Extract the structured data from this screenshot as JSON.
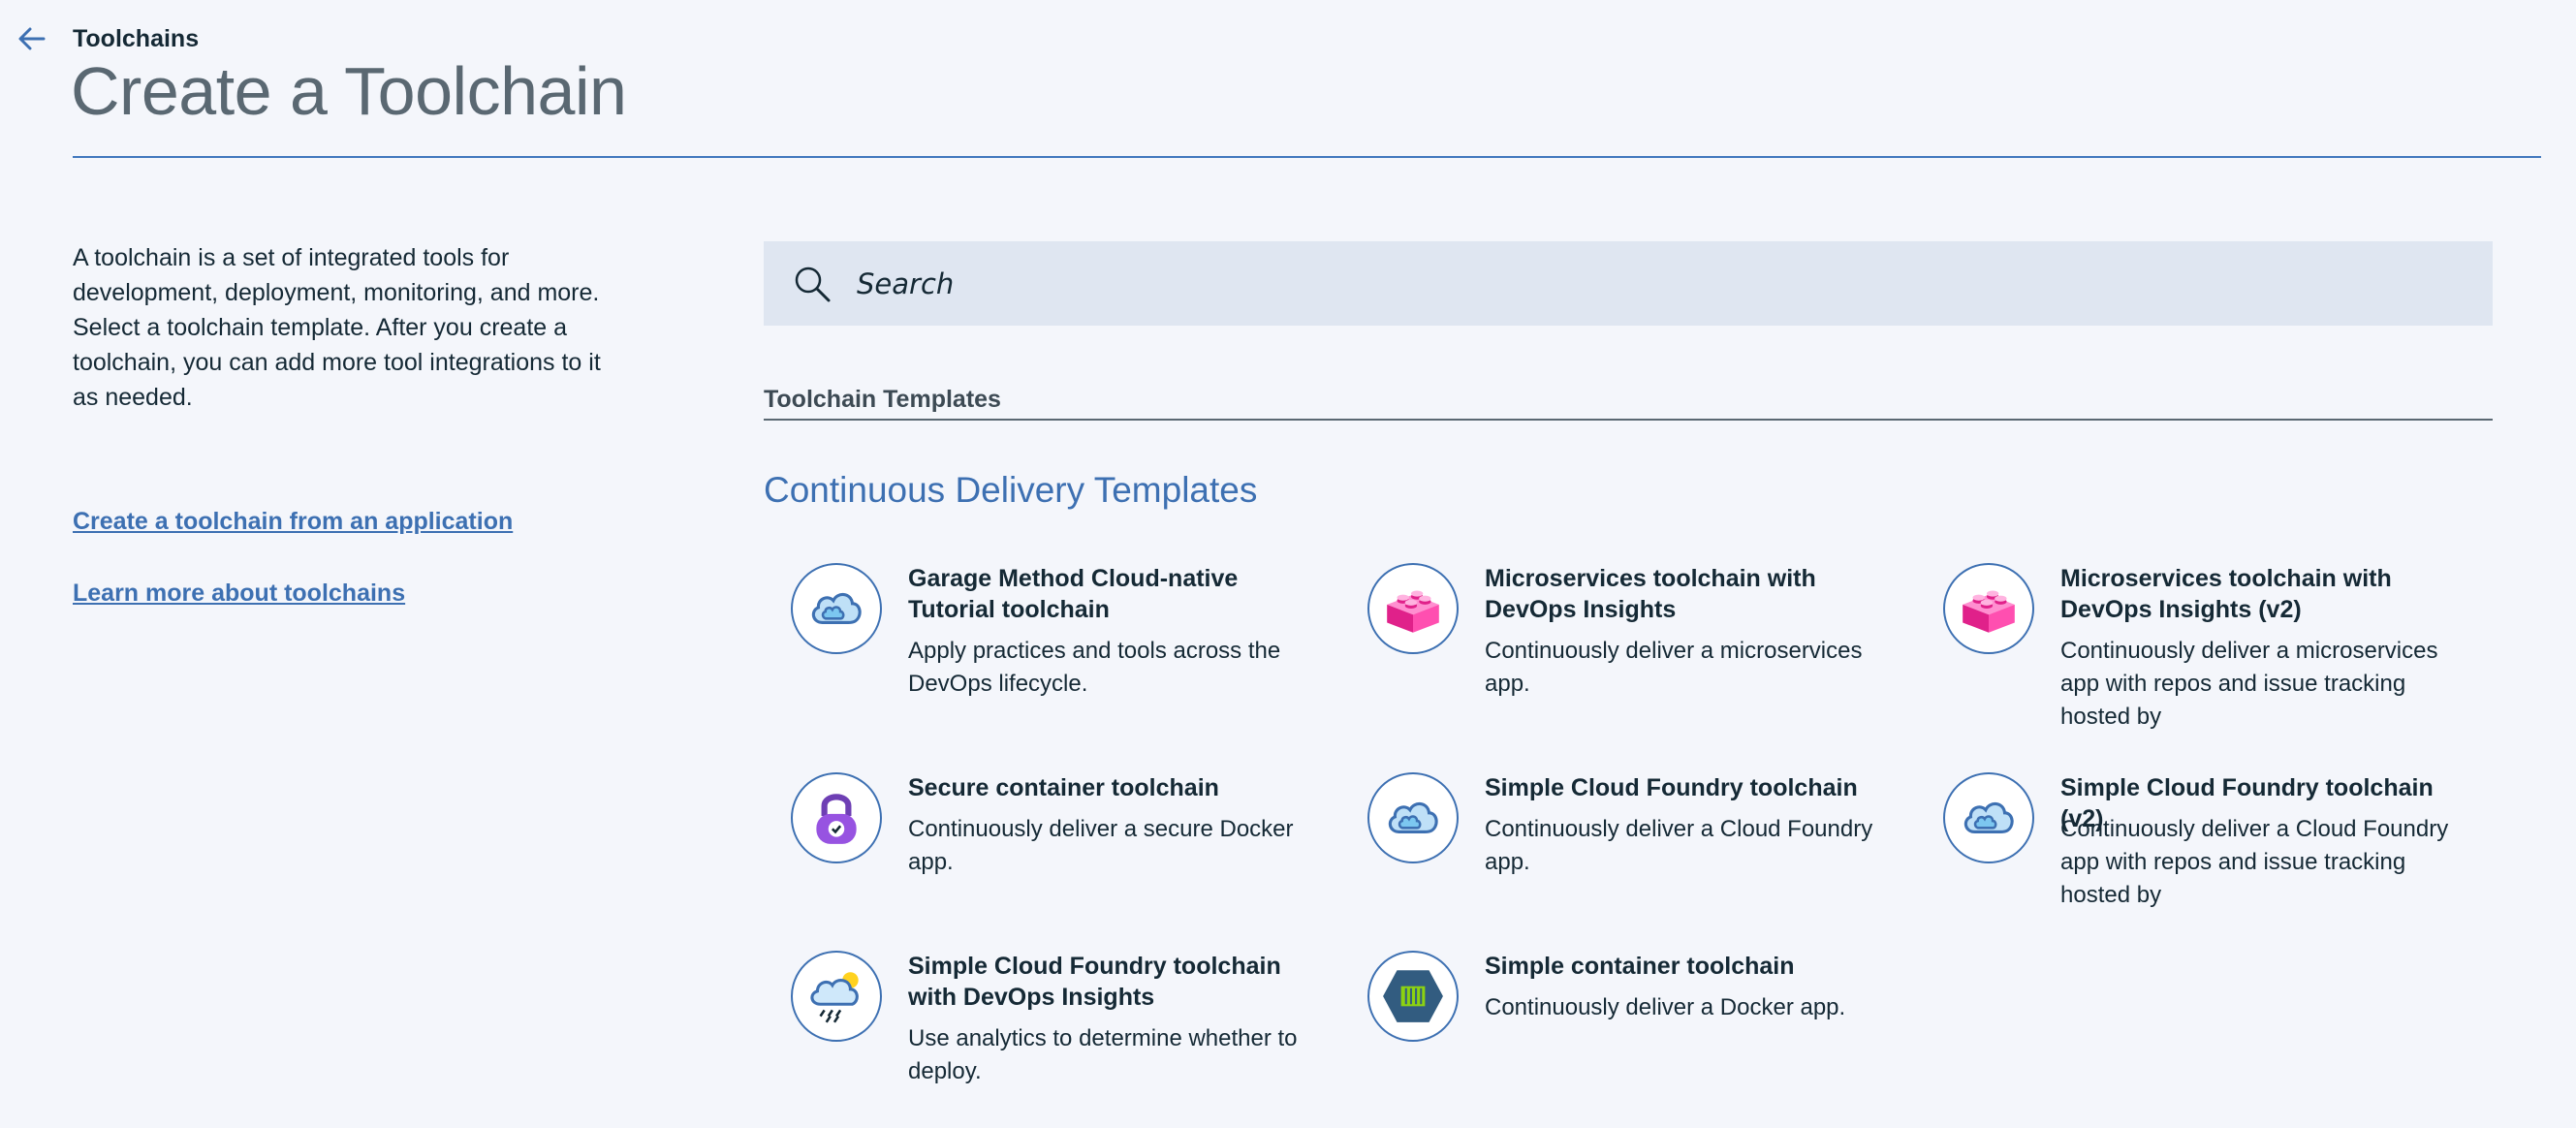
{
  "header": {
    "breadcrumb": "Toolchains",
    "title": "Create a Toolchain"
  },
  "sidebar": {
    "intro": "A toolchain is a set of integrated tools for development, deployment, monitoring, and more. Select a toolchain template. After you create a toolchain, you can add more tool integrations to it as needed.",
    "links": [
      "Create a toolchain from an application",
      "Learn more about toolchains"
    ]
  },
  "search": {
    "placeholder": "Search"
  },
  "section": {
    "label": "Toolchain Templates",
    "group_title": "Continuous Delivery Templates"
  },
  "templates": [
    {
      "title": "Garage Method Cloud-native Tutorial toolchain",
      "desc": "Apply practices and tools across the DevOps lifecycle.",
      "icon": "cloud-icon"
    },
    {
      "title": "Microservices toolchain with DevOps Insights",
      "desc": "Continuously deliver a microservices app.",
      "icon": "lego-brick-icon"
    },
    {
      "title": "Microservices toolchain with DevOps Insights (v2)",
      "desc": "Continuously deliver a microservices app with repos and issue tracking hosted by",
      "icon": "lego-brick-icon"
    },
    {
      "title": "Secure container toolchain",
      "desc": "Continuously deliver a secure Docker app.",
      "icon": "padlock-icon"
    },
    {
      "title": "Simple Cloud Foundry toolchain",
      "desc": "Continuously deliver a Cloud Foundry app.",
      "icon": "cloud-icon"
    },
    {
      "title": "Simple Cloud Foundry toolchain (v2)",
      "desc": "Continuously deliver a Cloud Foundry app with repos and issue tracking hosted by",
      "icon": "cloud-icon"
    },
    {
      "title": "Simple Cloud Foundry toolchain with DevOps Insights",
      "desc": "Use analytics to determine whether to deploy.",
      "icon": "cloud-weather-icon"
    },
    {
      "title": "Simple container toolchain",
      "desc": "Continuously deliver a Docker app.",
      "icon": "container-icon"
    }
  ],
  "colors": {
    "accent": "#3d70b2",
    "rule": "#4178be",
    "search_bg": "#dfe6f1",
    "page_bg": "#f4f6fb"
  }
}
